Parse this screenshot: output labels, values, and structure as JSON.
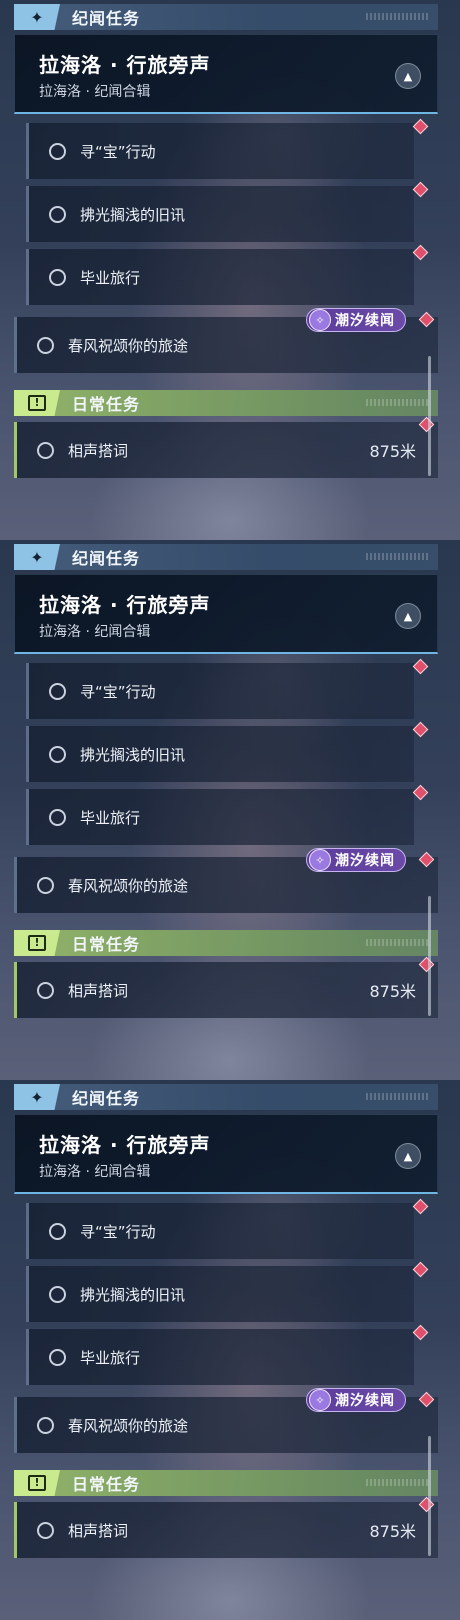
{
  "frames": [
    {
      "section_title": "纪闻任务",
      "section_icon": "sparkle-icon",
      "chapter": {
        "name": "拉海洛 · 行旅旁声",
        "subtitle": "拉海洛 · 纪闻合辑",
        "toggle_icon": "chevron-up-icon"
      },
      "quests": [
        {
          "label": "寻“宝”行动"
        },
        {
          "label": "拂光搁浅的旧讯"
        },
        {
          "label": "毕业旅行"
        }
      ],
      "special_quest": {
        "label": "春风祝颂你的旅途",
        "tag": "潮汐续闻"
      },
      "daily": {
        "title": "日常任务",
        "icon": "exclamation-box-icon",
        "quest": {
          "label": "相声搭词",
          "distance": "875米"
        }
      }
    },
    {
      "section_title": "纪闻任务",
      "section_icon": "sparkle-icon",
      "chapter": {
        "name": "拉海洛 · 行旅旁声",
        "subtitle": "拉海洛 · 纪闻合辑",
        "toggle_icon": "chevron-up-icon"
      },
      "quests": [
        {
          "label": "寻“宝”行动"
        },
        {
          "label": "拂光搁浅的旧讯"
        },
        {
          "label": "毕业旅行"
        }
      ],
      "special_quest": {
        "label": "春风祝颂你的旅途",
        "tag": "潮汐续闻"
      },
      "daily": {
        "title": "日常任务",
        "icon": "exclamation-box-icon",
        "quest": {
          "label": "相声搭词",
          "distance": "875米"
        }
      }
    },
    {
      "section_title": "纪闻任务",
      "section_icon": "sparkle-icon",
      "chapter": {
        "name": "拉海洛 · 行旅旁声",
        "subtitle": "拉海洛 · 纪闻合辑",
        "toggle_icon": "chevron-up-icon"
      },
      "quests": [
        {
          "label": "寻“宝”行动"
        },
        {
          "label": "拂光搁浅的旧讯"
        },
        {
          "label": "毕业旅行"
        }
      ],
      "special_quest": {
        "label": "春风祝颂你的旅途",
        "tag": "潮汐续闻"
      },
      "daily": {
        "title": "日常任务",
        "icon": "exclamation-box-icon",
        "quest": {
          "label": "相声搭词",
          "distance": "875米"
        }
      }
    }
  ],
  "colors": {
    "story_accent": "#8fc3e6",
    "daily_accent": "#c9ea8f",
    "tracking_marker": "#e0506b",
    "tide_tag": "#6b4aa8"
  }
}
